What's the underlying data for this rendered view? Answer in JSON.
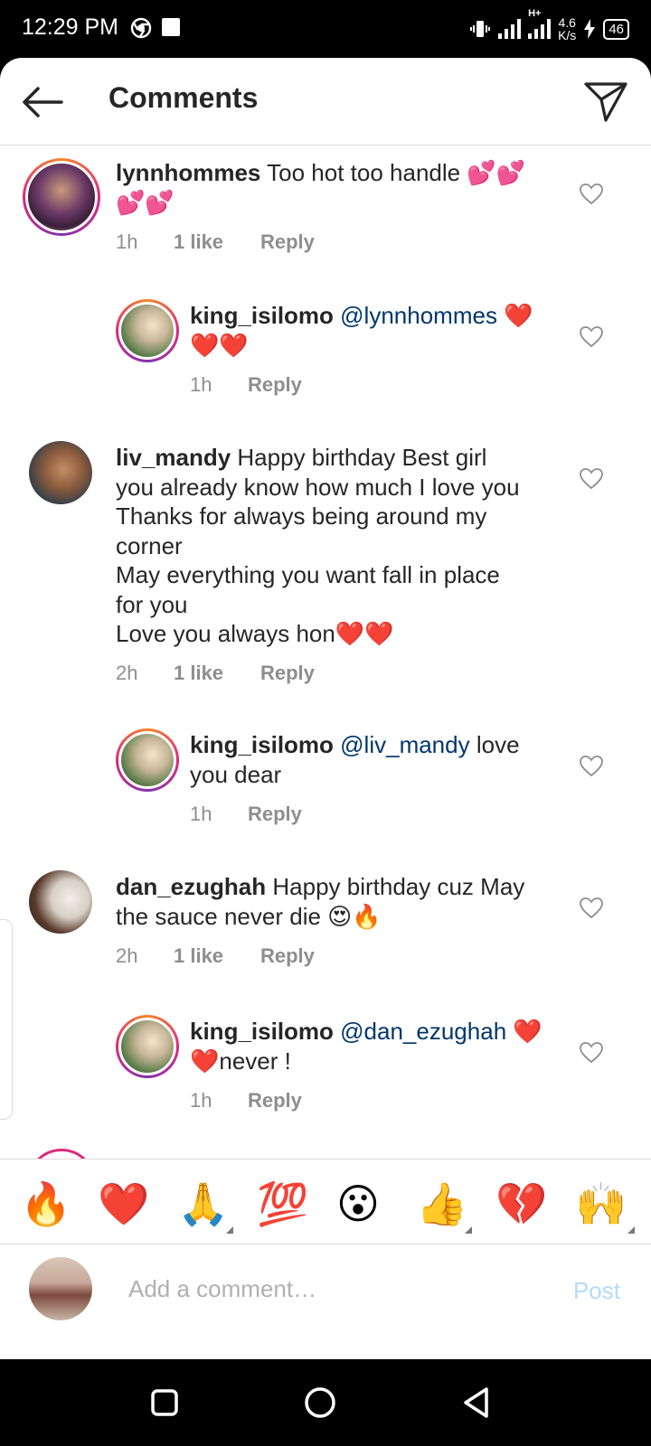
{
  "status": {
    "time": "12:29 PM",
    "network_speed": "4.6",
    "network_unit": "K/s",
    "network_type": "H+",
    "battery": "46"
  },
  "header": {
    "title": "Comments",
    "back_icon": "arrow-left-icon",
    "direct_icon": "paper-plane-icon"
  },
  "comments": [
    {
      "username": "lynnhommes",
      "text_a": "Too hot too handle 💕💕",
      "text_b": "💕💕",
      "time": "1h",
      "likes": "1 like",
      "reply": "Reply"
    },
    {
      "username": "king_isilomo",
      "mention": "@lynnhommes",
      "text_a": " ❤️",
      "text_b": "❤️❤️",
      "time": "1h",
      "reply": "Reply"
    },
    {
      "username": "liv_mandy",
      "text_a": "Happy birthday Best girl",
      "lines": [
        "you already know how much I love you",
        "Thanks for always being around my",
        "corner",
        "May everything you want fall in place",
        "for you",
        "Love you always hon❤️❤️"
      ],
      "time": "2h",
      "likes": "1 like",
      "reply": "Reply"
    },
    {
      "username": "king_isilomo",
      "mention": "@liv_mandy",
      "text_a": " love",
      "text_b": "you dear",
      "time": "1h",
      "reply": "Reply"
    },
    {
      "username": "dan_ezughah",
      "text_a": "Happy birthday cuz May",
      "text_b": "the sauce never die 😍🔥",
      "time": "2h",
      "likes": "1 like",
      "reply": "Reply"
    },
    {
      "username": "king_isilomo",
      "mention": "@dan_ezughah",
      "text_a": " ❤️",
      "text_b": "❤️never !",
      "time": "1h",
      "reply": "Reply"
    }
  ],
  "quick_emojis": [
    "🔥",
    "❤️",
    "🙏",
    "💯",
    "😮",
    "👍",
    "💔",
    "🙌"
  ],
  "composer": {
    "placeholder": "Add a comment…",
    "post_label": "Post"
  },
  "colors": {
    "text": "#262626",
    "secondary": "#8e8e8e",
    "mention": "#00376b",
    "post_disabled": "#b3dbff",
    "story_ring_start": "#f58529",
    "story_ring_end": "#dd2a7b"
  }
}
